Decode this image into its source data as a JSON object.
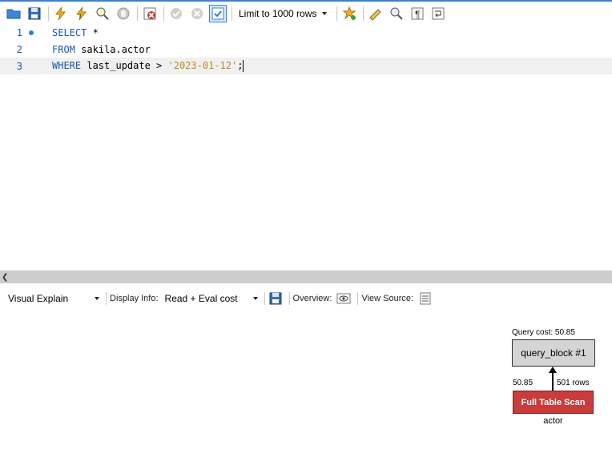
{
  "toolbar": {
    "buttons": [
      {
        "name": "open-folder-icon"
      },
      {
        "name": "save-icon"
      },
      {
        "name": "execute-icon"
      },
      {
        "name": "execute-current-icon"
      },
      {
        "name": "explain-icon"
      },
      {
        "name": "stop-icon"
      },
      {
        "name": "toggle-error-icon"
      },
      {
        "name": "commit-icon"
      },
      {
        "name": "rollback-icon"
      },
      {
        "name": "autocommit-icon"
      }
    ],
    "limit_label": "Limit to 1000 rows",
    "right_buttons": [
      {
        "name": "add-snippet-icon"
      },
      {
        "name": "beautify-icon"
      },
      {
        "name": "find-icon"
      },
      {
        "name": "invisible-chars-icon"
      },
      {
        "name": "wrap-lines-icon"
      }
    ]
  },
  "editor": {
    "lines": [
      {
        "num": "1",
        "kw": "SELECT",
        "rest": " *"
      },
      {
        "num": "2",
        "kw": "FROM",
        "rest": " sakila.actor"
      },
      {
        "num": "3",
        "kw": "WHERE",
        "rest": " last_update > ",
        "str": "'2023-01-12'",
        "tail": ";"
      }
    ]
  },
  "explain_bar": {
    "view_label": "Visual Explain",
    "display_info_label": "Display Info:",
    "display_info_value": "Read + Eval cost",
    "overview_label": "Overview:",
    "view_source_label": "View Source:"
  },
  "diagram": {
    "query_cost": "Query cost: 50.85",
    "query_block": "query_block #1",
    "cost": "50.85",
    "rows": "501 rows",
    "access_type": "Full Table Scan",
    "table": "actor"
  }
}
